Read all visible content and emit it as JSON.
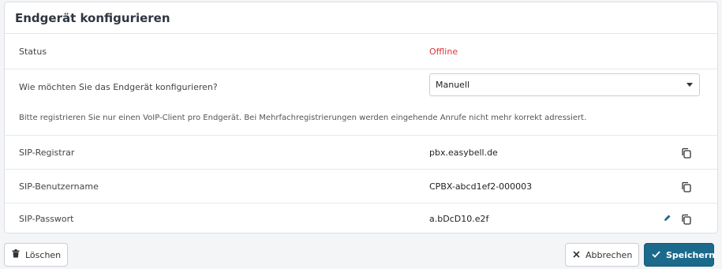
{
  "card": {
    "title": "Endgerät konfigurieren",
    "status_label": "Status",
    "status_value": "Offline",
    "config_label": "Wie möchten Sie das Endgerät konfigurieren?",
    "config_select_value": "Manuell",
    "hint": "Bitte registrieren Sie nur einen VoIP-Client pro Endgerät. Bei Mehrfachregistrierungen werden eingehende Anrufe nicht mehr korrekt adressiert.",
    "sip_registrar_label": "SIP-Registrar",
    "sip_registrar_value": "pbx.easybell.de",
    "sip_user_label": "SIP-Benutzername",
    "sip_user_value": "CPBX-abcd1ef2-000003",
    "sip_password_label": "SIP-Passwort",
    "sip_password_value": "a.bDcD10.e2f"
  },
  "footer": {
    "delete_label": "Löschen",
    "cancel_label": "Abbrechen",
    "save_label": "Speichern"
  },
  "colors": {
    "primary": "#1b6a8c",
    "offline": "#d7363b"
  }
}
